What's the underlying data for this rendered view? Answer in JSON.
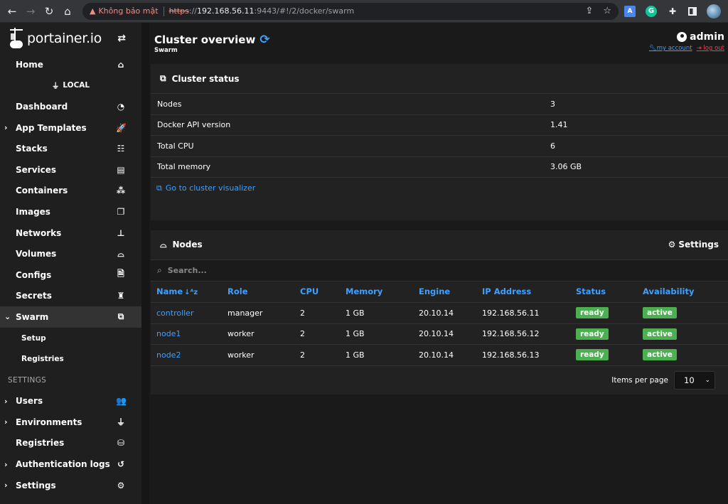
{
  "browser": {
    "security_label": "Không bảo mật",
    "url_scheme": "https",
    "url_sep": "://",
    "url_host": "192.168.56.11",
    "url_rest": ":9443/#!/2/docker/swarm"
  },
  "sidebar": {
    "logo_text": "portainer.io",
    "home_label": "Home",
    "environment_label": "LOCAL",
    "items": [
      {
        "label": "Dashboard",
        "icon": "tachometer-icon",
        "glyph": "◔",
        "chevron": ""
      },
      {
        "label": "App Templates",
        "icon": "rocket-icon",
        "glyph": "🚀",
        "chevron": "›"
      },
      {
        "label": "Stacks",
        "icon": "th-list-icon",
        "glyph": "☷",
        "chevron": ""
      },
      {
        "label": "Services",
        "icon": "list-alt-icon",
        "glyph": "▤",
        "chevron": ""
      },
      {
        "label": "Containers",
        "icon": "cubes-icon",
        "glyph": "⁂",
        "chevron": ""
      },
      {
        "label": "Images",
        "icon": "clone-icon",
        "glyph": "❐",
        "chevron": ""
      },
      {
        "label": "Networks",
        "icon": "sitemap-icon",
        "glyph": "⊥",
        "chevron": ""
      },
      {
        "label": "Volumes",
        "icon": "hdd-icon",
        "glyph": "⌓",
        "chevron": ""
      },
      {
        "label": "Configs",
        "icon": "file-code-icon",
        "glyph": "🗎",
        "chevron": ""
      },
      {
        "label": "Secrets",
        "icon": "user-secret-icon",
        "glyph": "♜",
        "chevron": ""
      },
      {
        "label": "Swarm",
        "icon": "object-group-icon",
        "glyph": "⧉",
        "chevron": "⌄"
      }
    ],
    "swarm_sub": [
      "Setup",
      "Registries"
    ],
    "settings_title": "SETTINGS",
    "settings_items": [
      {
        "label": "Users",
        "icon": "users-icon",
        "glyph": "👥",
        "chevron": "›"
      },
      {
        "label": "Environments",
        "icon": "plug-icon",
        "glyph": "⏚",
        "chevron": "›"
      },
      {
        "label": "Registries",
        "icon": "database-icon",
        "glyph": "⛁",
        "chevron": ""
      },
      {
        "label": "Authentication logs",
        "icon": "history-icon",
        "glyph": "↺",
        "chevron": "›"
      },
      {
        "label": "Settings",
        "icon": "cogs-icon",
        "glyph": "⚙",
        "chevron": "›"
      }
    ]
  },
  "header": {
    "title": "Cluster overview",
    "subtitle": "Swarm",
    "username": "admin",
    "my_account": "my account",
    "log_out": "log out"
  },
  "cluster_status": {
    "title": "Cluster status",
    "rows": [
      {
        "key": "Nodes",
        "value": "3"
      },
      {
        "key": "Docker API version",
        "value": "1.41"
      },
      {
        "key": "Total CPU",
        "value": "6"
      },
      {
        "key": "Total memory",
        "value": "3.06 GB"
      }
    ],
    "visualizer_link": "Go to cluster visualizer"
  },
  "nodes": {
    "title": "Nodes",
    "settings_label": "Settings",
    "search_placeholder": "Search...",
    "columns": [
      "Name",
      "Role",
      "CPU",
      "Memory",
      "Engine",
      "IP Address",
      "Status",
      "Availability"
    ],
    "rows": [
      {
        "name": "controller",
        "role": "manager",
        "cpu": "2",
        "memory": "1 GB",
        "engine": "20.10.14",
        "ip": "192.168.56.11",
        "status": "ready",
        "availability": "active"
      },
      {
        "name": "node1",
        "role": "worker",
        "cpu": "2",
        "memory": "1 GB",
        "engine": "20.10.14",
        "ip": "192.168.56.12",
        "status": "ready",
        "availability": "active"
      },
      {
        "name": "node2",
        "role": "worker",
        "cpu": "2",
        "memory": "1 GB",
        "engine": "20.10.14",
        "ip": "192.168.56.13",
        "status": "ready",
        "availability": "active"
      }
    ],
    "items_per_page_label": "Items per page",
    "items_per_page_value": "10"
  },
  "colors": {
    "accent": "#3ea0ff",
    "success": "#4caf50",
    "danger": "#f04444"
  }
}
